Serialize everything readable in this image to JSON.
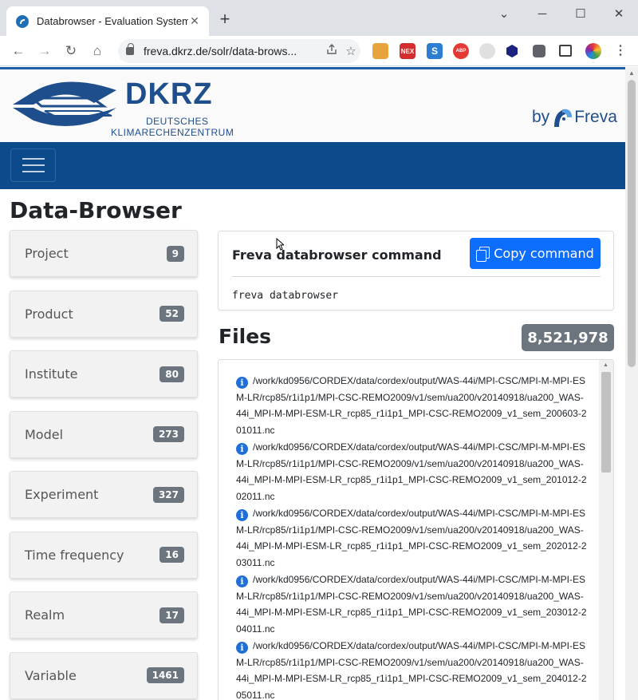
{
  "browser": {
    "tab_title": "Databrowser - Evaluation System",
    "tab_close": "✕",
    "new_tab": "+",
    "url": "freva.dkrz.de/solr/data-brows...",
    "window_controls": {
      "minimize": "⌄",
      "restore": "─",
      "maximize": "☐",
      "close": "✕"
    },
    "nav": {
      "back": "←",
      "forward": "→",
      "reload": "↻",
      "home": "⌂"
    },
    "omnibox_icons": [
      "share-icon",
      "star-icon"
    ],
    "extensions": [
      {
        "name": "paint-extension-icon",
        "label": "",
        "color": "#e8a33c"
      },
      {
        "name": "red-extension-icon",
        "label": "NEX",
        "color": "#d32f2f"
      },
      {
        "name": "s-extension-icon",
        "label": "S",
        "color": "#2d7dd2"
      },
      {
        "name": "abp-extension-icon",
        "label": "ABP",
        "color": "#e53935"
      },
      {
        "name": "circle-extension-icon",
        "label": "",
        "color": "#bdbdbd"
      },
      {
        "name": "hex-extension-icon",
        "label": "",
        "color": "#1a237e"
      },
      {
        "name": "puzzle-extension-icon",
        "label": "",
        "color": "#5f6368"
      },
      {
        "name": "sidepanel-icon",
        "label": "",
        "color": "#3c4043"
      },
      {
        "name": "profile-avatar-icon",
        "label": "",
        "color": "#7cb342"
      }
    ]
  },
  "header": {
    "brand_name": "DKRZ",
    "brand_sub1": "DEUTSCHES",
    "brand_sub2": "KLIMARECHENZENTRUM",
    "by_label": "by",
    "freva_label": "Freva",
    "brand_color": "#1f4e8c",
    "navbar_color": "#0c4a8c"
  },
  "page": {
    "title": "Data-Browser"
  },
  "facets": [
    {
      "label": "Project",
      "count": "9"
    },
    {
      "label": "Product",
      "count": "52"
    },
    {
      "label": "Institute",
      "count": "80"
    },
    {
      "label": "Model",
      "count": "273"
    },
    {
      "label": "Experiment",
      "count": "327"
    },
    {
      "label": "Time frequency",
      "count": "16"
    },
    {
      "label": "Realm",
      "count": "17"
    },
    {
      "label": "Variable",
      "count": "1461"
    }
  ],
  "command": {
    "title": "Freva databrowser command",
    "copy_label": "Copy command",
    "text": "freva databrowser"
  },
  "files": {
    "title": "Files",
    "count": "8,521,978",
    "items": [
      "/work/kd0956/CORDEX/data/cordex/output/WAS-44i/MPI-CSC/MPI-M-MPI-ESM-LR/rcp85/r1i1p1/MPI-CSC-REMO2009/v1/sem/ua200/v20140918/ua200_WAS-44i_MPI-M-MPI-ESM-LR_rcp85_r1i1p1_MPI-CSC-REMO2009_v1_sem_200603-201011.nc",
      "/work/kd0956/CORDEX/data/cordex/output/WAS-44i/MPI-CSC/MPI-M-MPI-ESM-LR/rcp85/r1i1p1/MPI-CSC-REMO2009/v1/sem/ua200/v20140918/ua200_WAS-44i_MPI-M-MPI-ESM-LR_rcp85_r1i1p1_MPI-CSC-REMO2009_v1_sem_201012-202011.nc",
      "/work/kd0956/CORDEX/data/cordex/output/WAS-44i/MPI-CSC/MPI-M-MPI-ESM-LR/rcp85/r1i1p1/MPI-CSC-REMO2009/v1/sem/ua200/v20140918/ua200_WAS-44i_MPI-M-MPI-ESM-LR_rcp85_r1i1p1_MPI-CSC-REMO2009_v1_sem_202012-203011.nc",
      "/work/kd0956/CORDEX/data/cordex/output/WAS-44i/MPI-CSC/MPI-M-MPI-ESM-LR/rcp85/r1i1p1/MPI-CSC-REMO2009/v1/sem/ua200/v20140918/ua200_WAS-44i_MPI-M-MPI-ESM-LR_rcp85_r1i1p1_MPI-CSC-REMO2009_v1_sem_203012-204011.nc",
      "/work/kd0956/CORDEX/data/cordex/output/WAS-44i/MPI-CSC/MPI-M-MPI-ESM-LR/rcp85/r1i1p1/MPI-CSC-REMO2009/v1/sem/ua200/v20140918/ua200_WAS-44i_MPI-M-MPI-ESM-LR_rcp85_r1i1p1_MPI-CSC-REMO2009_v1_sem_204012-205011.nc"
    ]
  }
}
